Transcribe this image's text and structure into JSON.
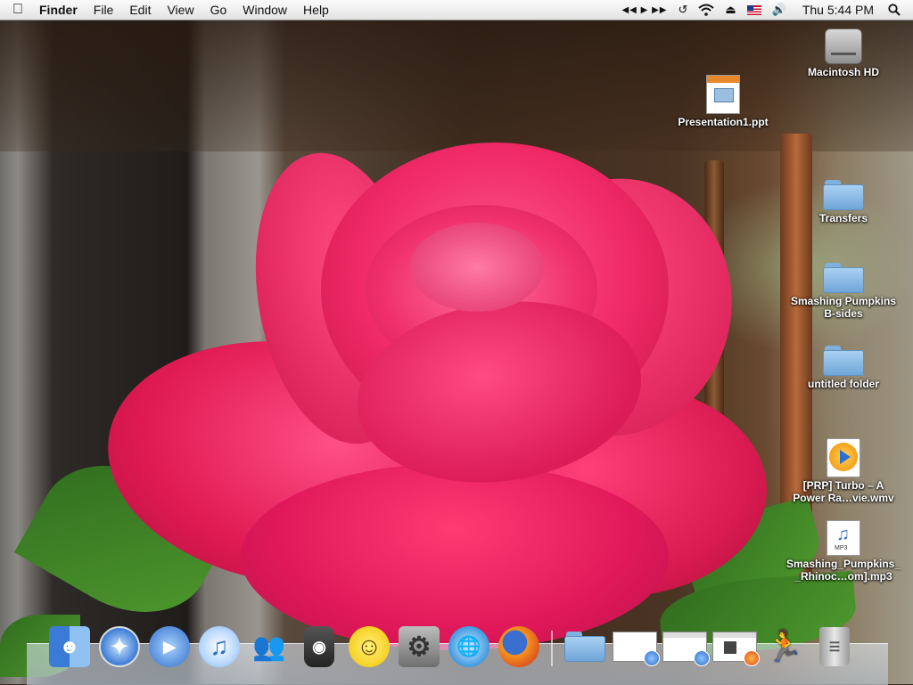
{
  "menubar": {
    "app_name": "Finder",
    "menus": [
      "File",
      "Edit",
      "View",
      "Go",
      "Window",
      "Help"
    ],
    "tray_icons": [
      "media-controls-icon",
      "time-machine-icon",
      "wifi-icon",
      "eject-icon",
      "flag-icon",
      "volume-icon"
    ],
    "clock": "Thu 5:44 PM"
  },
  "desktop": {
    "icons": [
      {
        "label": "Macintosh HD",
        "kind": "hard-disk"
      },
      {
        "label": "Presentation1.ppt",
        "kind": "powerpoint-document"
      },
      {
        "label": "Transfers",
        "kind": "folder"
      },
      {
        "label_line1": "Smashing Pumpkins",
        "label_line2": "B-sides",
        "kind": "folder"
      },
      {
        "label": "untitled folder",
        "kind": "folder"
      },
      {
        "label_line1": "[PRP] Turbo – A",
        "label_line2": "Power Ra…vie.wmv",
        "kind": "video-file"
      },
      {
        "label_line1": "Smashing_Pumpkins_",
        "label_line2": "_Rhinoc…om].mp3",
        "kind": "mp3-file"
      }
    ]
  },
  "dock": {
    "apps": [
      "Finder",
      "Safari",
      "iChat",
      "iTunes",
      "Messenger",
      "Audio Hijack",
      "Yahoo Messenger",
      "System Preferences",
      "Internet",
      "Firefox"
    ],
    "right": [
      "Applications",
      "minimized window",
      "minimized window",
      "minimized window",
      "AIM",
      "Trash"
    ]
  },
  "colors": {
    "menubar_bg": "#ececec",
    "folder_blue": "#8cbde8",
    "rose_pink": "#e8245a"
  }
}
